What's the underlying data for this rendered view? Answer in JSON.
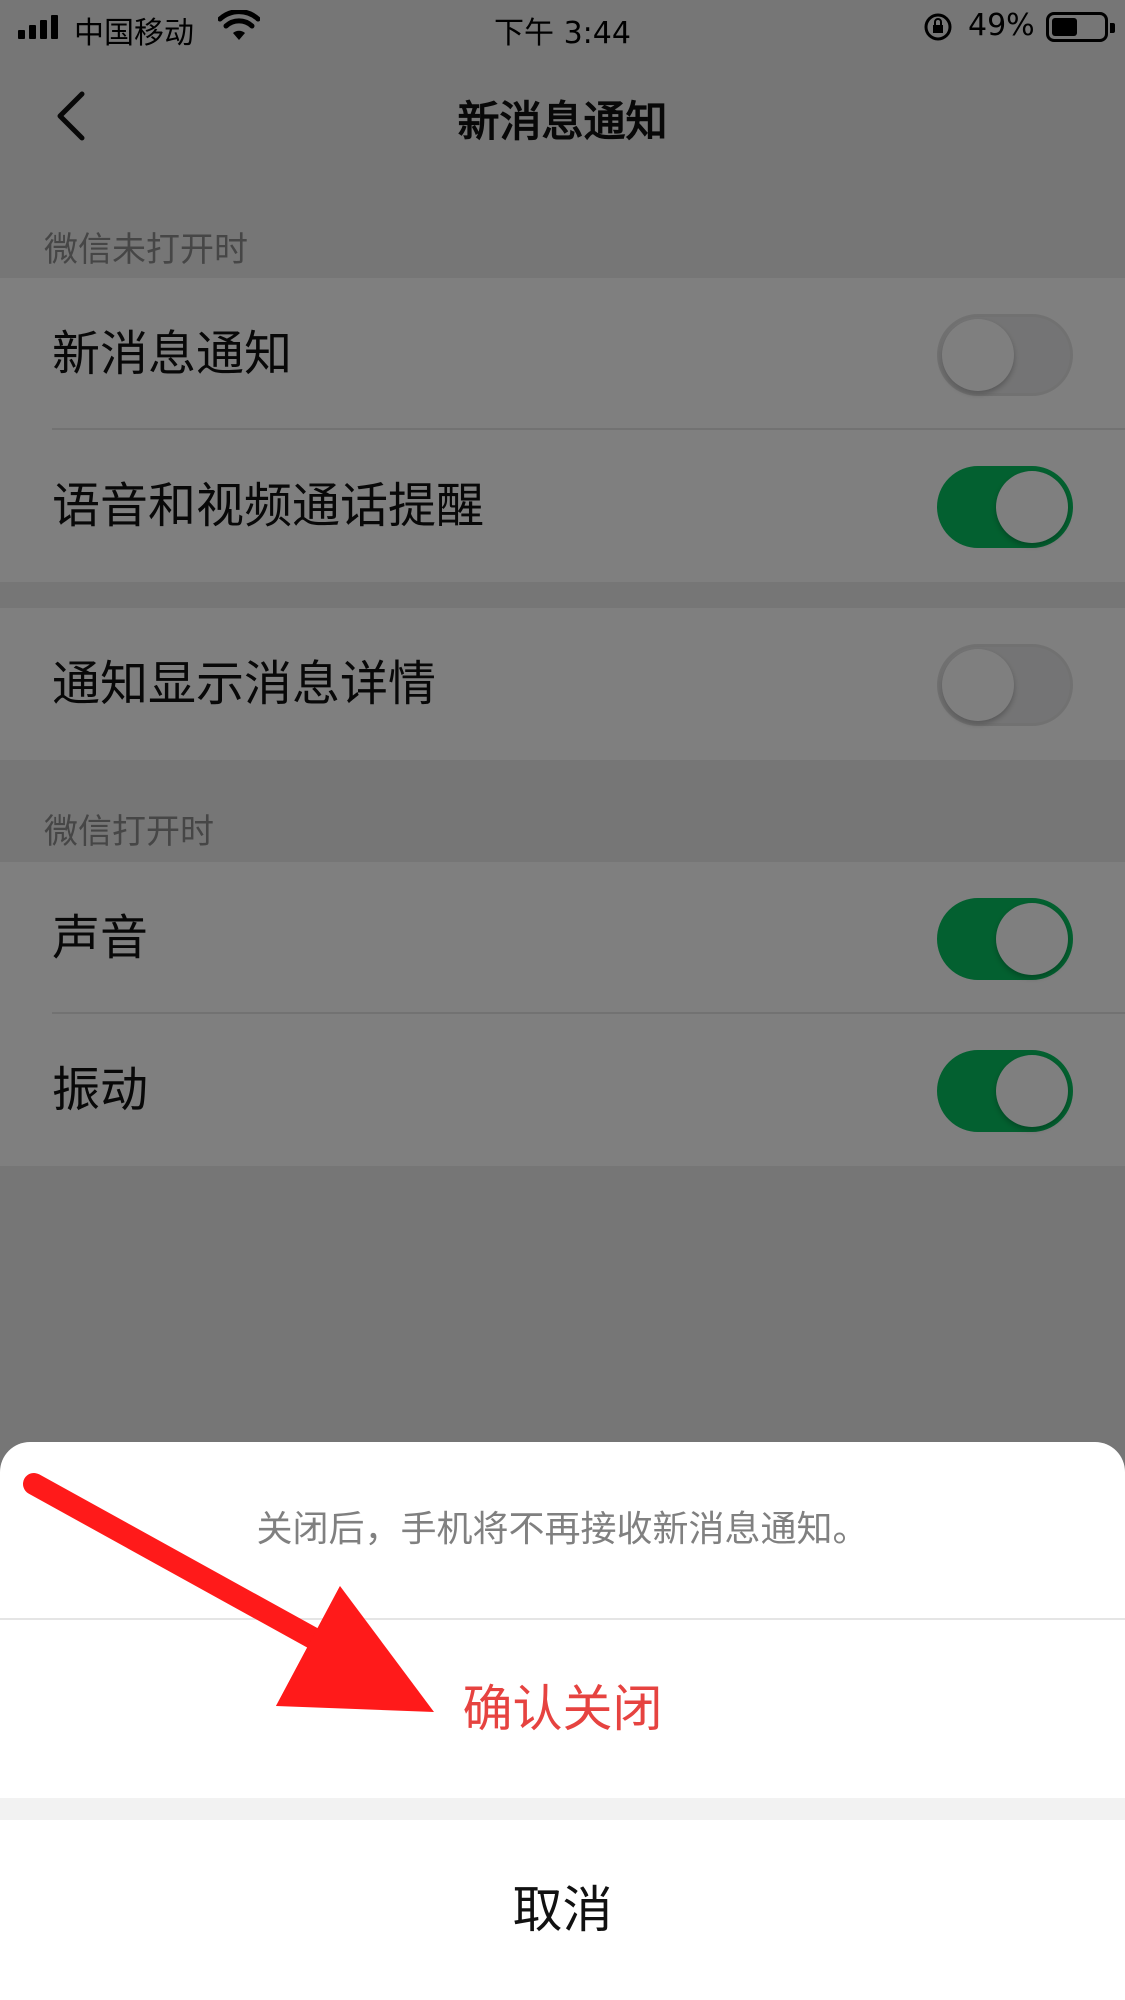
{
  "status_bar": {
    "carrier": "中国移动",
    "time": "下午 3:44",
    "battery_percent": "49%",
    "battery_level": 0.49
  },
  "nav": {
    "title": "新消息通知"
  },
  "sections": [
    {
      "header": "微信未打开时",
      "rows": [
        {
          "label": "新消息通知",
          "on": false
        },
        {
          "label": "语音和视频通话提醒",
          "on": true
        }
      ]
    },
    {
      "header": "",
      "rows": [
        {
          "label": "通知显示消息详情",
          "on": false
        }
      ]
    },
    {
      "header": "微信打开时",
      "rows": [
        {
          "label": "声音",
          "on": true
        },
        {
          "label": "振动",
          "on": true
        }
      ]
    }
  ],
  "action_sheet": {
    "message": "关闭后，手机将不再接收新消息通知。",
    "confirm_label": "确认关闭",
    "cancel_label": "取消"
  },
  "colors": {
    "toggle_on": "#07c160",
    "destructive": "#e64340",
    "annotation_arrow": "#ff1a1a"
  }
}
